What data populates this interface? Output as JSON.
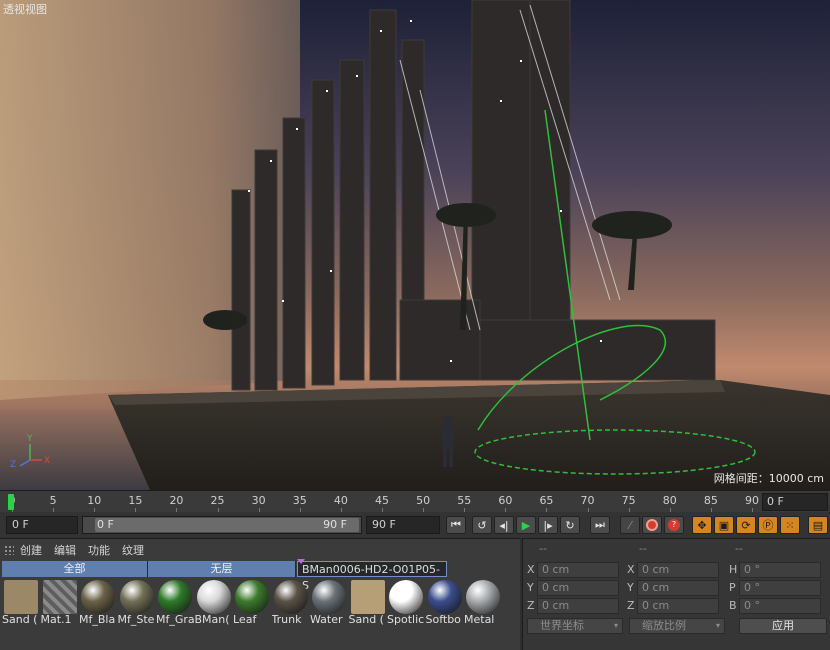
{
  "viewport": {
    "title": "透视视图",
    "grid_note": "网格间距：10000 cm",
    "axes": {
      "x": "X",
      "y": "Y",
      "z": "Z"
    }
  },
  "timeline": {
    "ticks": [
      "0",
      "5",
      "10",
      "15",
      "20",
      "25",
      "30",
      "35",
      "40",
      "45",
      "50",
      "55",
      "60",
      "65",
      "70",
      "75",
      "80",
      "85",
      "90"
    ],
    "current_frame": "0 F"
  },
  "transport": {
    "start_field": "0 F",
    "range_start": "0 F",
    "range_end": "90 F",
    "end_field": "90 F",
    "buttons": {
      "go_start": "first-frame-icon",
      "prev_key": "prev-key-icon",
      "prev_frame": "prev-frame-icon",
      "play": "play-icon",
      "next_frame": "next-frame-icon",
      "next_key": "next-key-icon",
      "go_end": "last-frame-icon",
      "key_record_colors": {
        "record": "#d83a2f",
        "auto": "#d83a2f"
      }
    }
  },
  "material_manager": {
    "menu": [
      "创建",
      "编辑",
      "功能",
      "纹理"
    ],
    "layers": [
      "全部",
      "无层",
      "BMan0006-HD2-O01P05-S"
    ],
    "materials": [
      {
        "label": "Sand (",
        "color": "#9a8866"
      },
      {
        "label": "Mat.1",
        "color": "#7d7d7d"
      },
      {
        "label": "Mf_Bla",
        "color": "#6b6248"
      },
      {
        "label": "Mf_Ste",
        "color": "#727057"
      },
      {
        "label": "Mf_Gra",
        "color": "#2f7a2a"
      },
      {
        "label": "BMan(",
        "color": "#d9d9d9"
      },
      {
        "label": "Leaf",
        "color": "#3d7b2d"
      },
      {
        "label": "Trunk",
        "color": "#5a5247"
      },
      {
        "label": "Water",
        "color": "#6a7278"
      },
      {
        "label": "Sand (",
        "color": "#b69e77"
      },
      {
        "label": "Spotlic",
        "color": "#ffffff"
      },
      {
        "label": "Softbo",
        "color": "#3b4e8e"
      },
      {
        "label": "Metal",
        "color": "#a9adb0"
      }
    ]
  },
  "coordinates": {
    "headers": [
      "--",
      "--",
      "--"
    ],
    "rows": [
      {
        "a": "X",
        "av": "0 cm",
        "b": "X",
        "bv": "0 cm",
        "c": "H",
        "cv": "0 °"
      },
      {
        "a": "Y",
        "av": "0 cm",
        "b": "Y",
        "bv": "0 cm",
        "c": "P",
        "cv": "0 °"
      },
      {
        "a": "Z",
        "av": "0 cm",
        "b": "Z",
        "bv": "0 cm",
        "c": "B",
        "cv": "0 °"
      }
    ],
    "mode_world": "世界坐标",
    "mode_scale": "缩放比例",
    "apply": "应用"
  }
}
